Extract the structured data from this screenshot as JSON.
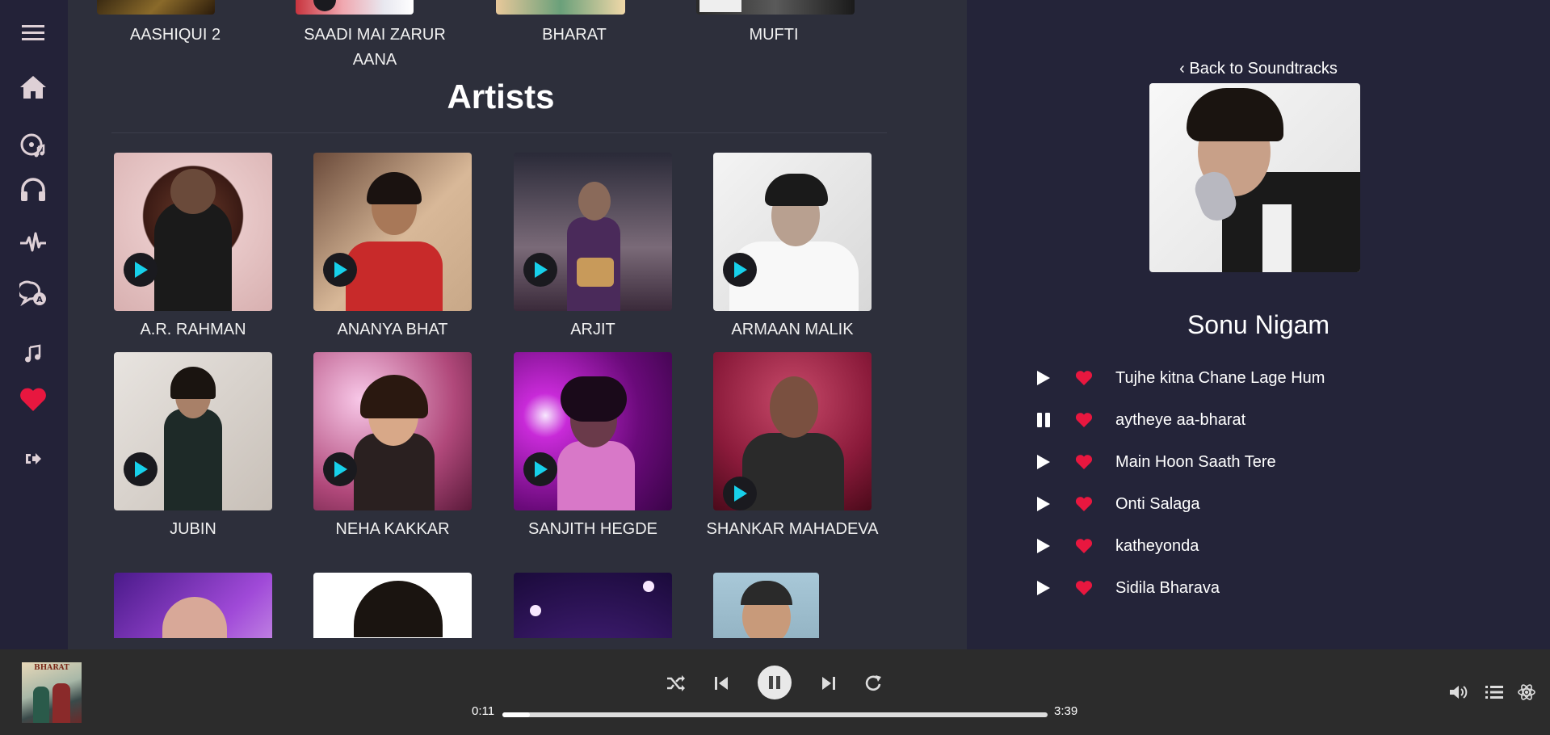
{
  "colors": {
    "accent_red": "#e8173f",
    "play_cyan": "#17d0ea",
    "sidebar_icon": "#ded0d6"
  },
  "sidebar": {
    "items": [
      {
        "icon": "menu-icon"
      },
      {
        "icon": "home-icon"
      },
      {
        "icon": "music-disc-icon"
      },
      {
        "icon": "headphones-icon"
      },
      {
        "icon": "pulse-icon"
      },
      {
        "icon": "chat-translate-icon"
      },
      {
        "icon": "music-note-icon"
      },
      {
        "icon": "heart-icon"
      },
      {
        "icon": "logout-icon"
      }
    ]
  },
  "albums": [
    {
      "title": "AASHIQUI 2"
    },
    {
      "title": "SAADI MAI ZARUR AANA"
    },
    {
      "title": "BHARAT"
    },
    {
      "title": "MUFTI"
    }
  ],
  "artists_section": {
    "title": "Artists",
    "artists": [
      {
        "name": "A.R. RAHMAN"
      },
      {
        "name": "ANANYA BHAT"
      },
      {
        "name": "ARJIT"
      },
      {
        "name": "ARMAAN MALIK"
      },
      {
        "name": "JUBIN"
      },
      {
        "name": "NEHA KAKKAR"
      },
      {
        "name": "SANJITH HEGDE"
      },
      {
        "name": "SHANKAR MAHADEVA"
      }
    ]
  },
  "detail": {
    "back_label": "‹ Back to Soundtracks",
    "artist_name": "Sonu Nigam",
    "tracks": [
      {
        "title": "Tujhe kitna Chane Lage Hum",
        "state": "play"
      },
      {
        "title": "aytheye aa-bharat",
        "state": "pause"
      },
      {
        "title": "Main Hoon Saath Tere",
        "state": "play"
      },
      {
        "title": "Onti Salaga",
        "state": "play"
      },
      {
        "title": "katheyonda",
        "state": "play"
      },
      {
        "title": "Sidila Bharava",
        "state": "play"
      }
    ]
  },
  "player": {
    "cover_text": "BHARAT",
    "current_time": "0:11",
    "total_time": "3:39",
    "progress": 0.05
  }
}
